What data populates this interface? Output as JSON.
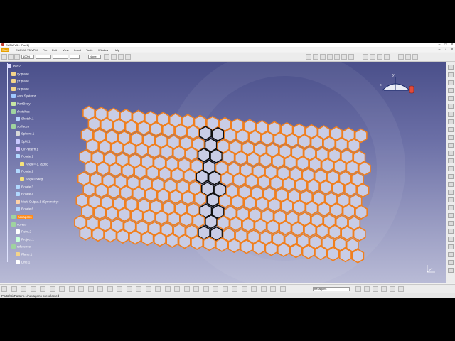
{
  "window": {
    "title": "CATIA V5 - [Part1]"
  },
  "menu": {
    "items": [
      "Start",
      "ENOVIA V5 VPM",
      "File",
      "Edit",
      "View",
      "Insert",
      "Tools",
      "Window",
      "Help"
    ]
  },
  "toolbar": {
    "zoom_value": "100%",
    "style_value": "None"
  },
  "tree": {
    "items": [
      {
        "label": "Part2",
        "icon": "part-icon"
      },
      {
        "label": "xy plane",
        "icon": "plane-icon"
      },
      {
        "label": "yz plane",
        "icon": "plane-icon"
      },
      {
        "label": "zx plane",
        "icon": "plane-icon"
      },
      {
        "label": "Axis Systems",
        "icon": "axis-systems-icon"
      },
      {
        "label": "PartBody",
        "icon": "partbody-icon"
      },
      {
        "label": "sketches",
        "icon": "geometrical-set-icon"
      },
      {
        "label": "Sketch.1",
        "icon": "sketch-icon"
      },
      {
        "label": "surfaces",
        "icon": "geometrical-set-icon"
      },
      {
        "label": "Sphere.1",
        "icon": "sphere-icon"
      },
      {
        "label": "Split.1",
        "icon": "split-icon"
      },
      {
        "label": "CirPattern.1",
        "icon": "pattern-icon"
      },
      {
        "label": "Rotate.1",
        "icon": "rotate-icon"
      },
      {
        "label": "Angle=-1.75deg",
        "icon": "parameter-icon"
      },
      {
        "label": "Rotate.2",
        "icon": "rotate-icon"
      },
      {
        "label": "Angle=3deg",
        "icon": "parameter-icon"
      },
      {
        "label": "Rotate.3",
        "icon": "rotate-icon"
      },
      {
        "label": "Rotate.4",
        "icon": "rotate-icon"
      },
      {
        "label": "Multi Output.1 (Symmetry)",
        "icon": "multi-output-icon"
      },
      {
        "label": "Rotate.6",
        "icon": "rotate-icon"
      },
      {
        "label": "hexagons",
        "icon": "geometrical-set-icon"
      },
      {
        "label": "curves",
        "icon": "geometrical-set-icon"
      },
      {
        "label": "Point.2",
        "icon": "point-icon"
      },
      {
        "label": "Project.1",
        "icon": "project-icon"
      },
      {
        "label": "reference",
        "icon": "geometrical-set-icon"
      },
      {
        "label": "Plane.1",
        "icon": "plane-icon"
      },
      {
        "label": "Line.1",
        "icon": "line-icon"
      }
    ]
  },
  "bottom_toolbar": {
    "selection_value": "hexagons"
  },
  "statusbar": {
    "text": "Part2/CirPattern.1/hexagons preselected"
  },
  "colors": {
    "hex_fill": "#c9cde6",
    "hex_stroke": "#f07f1e",
    "hex_selected_stroke": "#111111",
    "background_top": "#4a4f8a",
    "background_bottom": "#b9bbd6",
    "tree_selected": "#ff8c1a"
  }
}
